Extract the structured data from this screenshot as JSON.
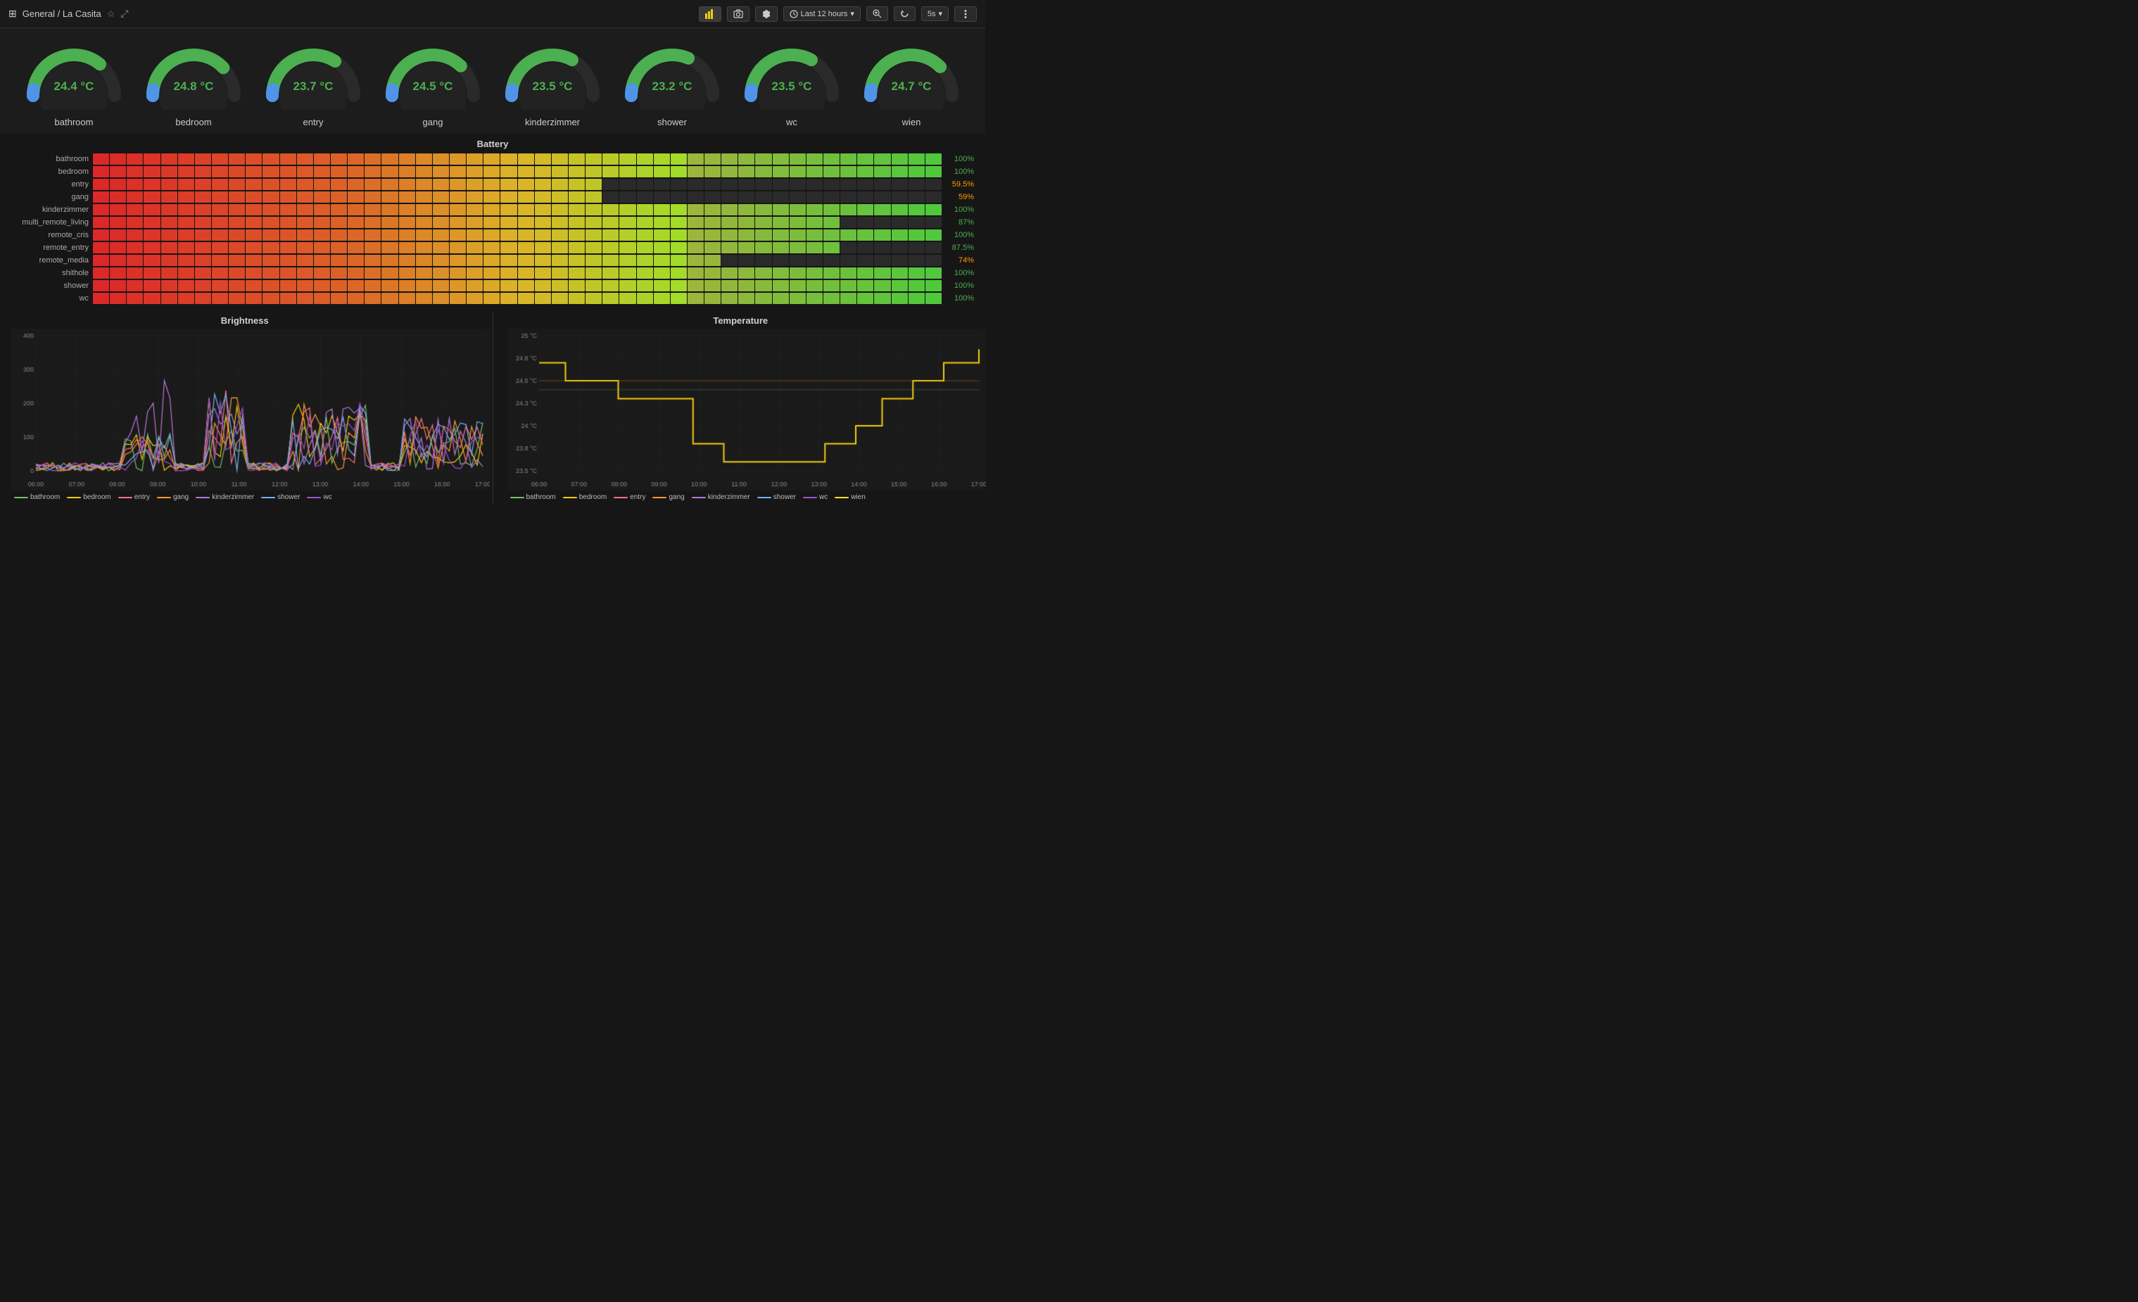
{
  "header": {
    "grid_icon": "⊞",
    "title": "General / La Casita",
    "star_icon": "☆",
    "share_icon": "⤢",
    "bar_chart_icon": "📊",
    "screenshot_icon": "📷",
    "settings_icon": "⚙",
    "time_label": "Last 12 hours",
    "zoom_icon": "🔍",
    "refresh_icon": "↻",
    "interval_label": "5s",
    "menu_icon": "☰"
  },
  "gauges": [
    {
      "label": "bathroom",
      "value": "24.4 °C",
      "pct": 0.72
    },
    {
      "label": "bedroom",
      "value": "24.8 °C",
      "pct": 0.76
    },
    {
      "label": "entry",
      "value": "23.7 °C",
      "pct": 0.68
    },
    {
      "label": "gang",
      "value": "24.5 °C",
      "pct": 0.74
    },
    {
      "label": "kinderzimmer",
      "value": "23.5 °C",
      "pct": 0.66
    },
    {
      "label": "shower",
      "value": "23.2 °C",
      "pct": 0.63
    },
    {
      "label": "wc",
      "value": "23.5 °C",
      "pct": 0.66
    },
    {
      "label": "wien",
      "value": "24.7 °C",
      "pct": 0.75
    }
  ],
  "battery": {
    "title": "Battery",
    "rows": [
      {
        "label": "bathroom",
        "pct": 100,
        "pct_label": "100%",
        "color": "#4caf50"
      },
      {
        "label": "bedroom",
        "pct": 100,
        "pct_label": "100%",
        "color": "#4caf50"
      },
      {
        "label": "entry",
        "pct": 59.5,
        "pct_label": "59.5%",
        "color": "#ff9800"
      },
      {
        "label": "gang",
        "pct": 59,
        "pct_label": "59%",
        "color": "#ff9800"
      },
      {
        "label": "kinderzimmer",
        "pct": 100,
        "pct_label": "100%",
        "color": "#4caf50"
      },
      {
        "label": "multi_remote_living",
        "pct": 87,
        "pct_label": "87%",
        "color": "#4caf50"
      },
      {
        "label": "remote_cris",
        "pct": 100,
        "pct_label": "100%",
        "color": "#4caf50"
      },
      {
        "label": "remote_entry",
        "pct": 87.5,
        "pct_label": "87.5%",
        "color": "#4caf50"
      },
      {
        "label": "remote_media",
        "pct": 74,
        "pct_label": "74%",
        "color": "#ff9800"
      },
      {
        "label": "shithole",
        "pct": 100,
        "pct_label": "100%",
        "color": "#4caf50"
      },
      {
        "label": "shower",
        "pct": 100,
        "pct_label": "100%",
        "color": "#4caf50"
      },
      {
        "label": "wc",
        "pct": 100,
        "pct_label": "100%",
        "color": "#4caf50"
      }
    ],
    "cell_count": 50
  },
  "brightness": {
    "title": "Brightness",
    "y_labels": [
      "400",
      "300",
      "200",
      "100",
      "0"
    ],
    "x_labels": [
      "06:00",
      "07:00",
      "08:00",
      "09:00",
      "10:00",
      "11:00",
      "12:00",
      "13:00",
      "14:00",
      "15:00",
      "16:00",
      "17:00"
    ],
    "legend": [
      {
        "label": "bathroom",
        "color": "#73bf69"
      },
      {
        "label": "bedroom",
        "color": "#f2cc0c"
      },
      {
        "label": "entry",
        "color": "#ff7383"
      },
      {
        "label": "gang",
        "color": "#ff9830"
      },
      {
        "label": "kinderzimmer",
        "color": "#b877d9"
      },
      {
        "label": "shower",
        "color": "#73b0f4"
      },
      {
        "label": "wc",
        "color": "#a352cc"
      }
    ]
  },
  "temperature": {
    "title": "Temperature",
    "y_labels": [
      "25 °C",
      "24.8 °C",
      "24.5 °C",
      "24.3 °C",
      "24 °C",
      "23.8 °C",
      "23.5 °C"
    ],
    "x_labels": [
      "06:00",
      "07:00",
      "08:00",
      "09:00",
      "10:00",
      "11:00",
      "12:00",
      "13:00",
      "14:00",
      "15:00",
      "16:00",
      "17:00"
    ],
    "legend": [
      {
        "label": "bathroom",
        "color": "#73bf69"
      },
      {
        "label": "bedroom",
        "color": "#f2cc0c"
      },
      {
        "label": "entry",
        "color": "#ff7383"
      },
      {
        "label": "gang",
        "color": "#ff9830"
      },
      {
        "label": "kinderzimmer",
        "color": "#b877d9"
      },
      {
        "label": "shower",
        "color": "#73b0f4"
      },
      {
        "label": "wc",
        "color": "#a352cc"
      },
      {
        "label": "wien",
        "color": "#fade2a"
      }
    ]
  }
}
